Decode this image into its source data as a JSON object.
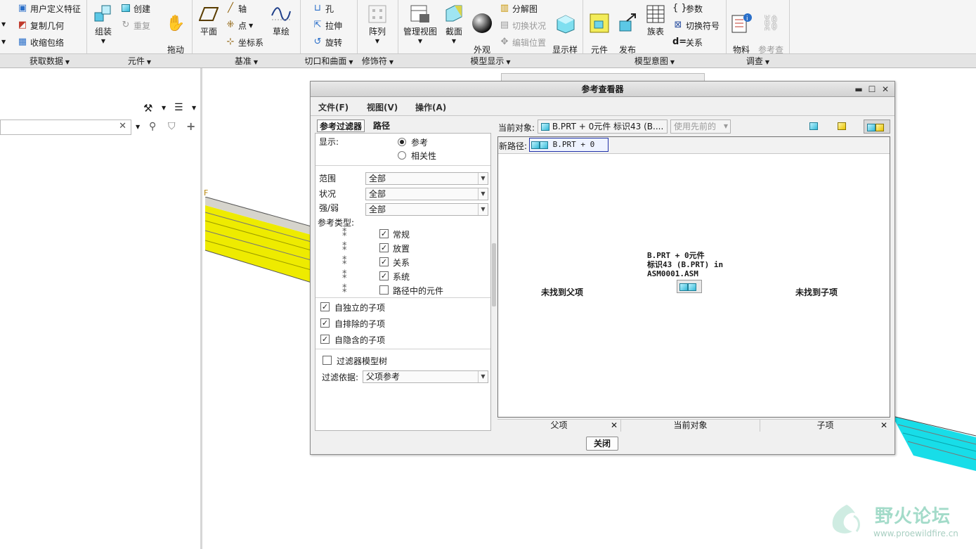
{
  "ribbon": {
    "get_data": {
      "label": "获取数据",
      "items": [
        "用户定义特征",
        "复制几何",
        "收缩包络"
      ]
    },
    "component": {
      "label": "元件",
      "assemble": "组装",
      "create": "创建",
      "repeat": "重复",
      "drag": "拖动\n元件"
    },
    "datum": {
      "label": "基准",
      "plane": "平面",
      "axis": "轴",
      "point": "点",
      "csys": "坐标系",
      "sketch": "草绘"
    },
    "cut_surface": {
      "label": "切口和曲面",
      "hole": "孔",
      "extrude": "拉伸",
      "revolve": "旋转"
    },
    "modifier": {
      "label": "修饰符",
      "pattern": "阵列"
    },
    "model_display": {
      "label": "模型显示",
      "manage_views": "管理视图",
      "section": "截面",
      "appearance": "外观\n库",
      "exploded": "分解图",
      "toggle_status": "切换状况",
      "edit_position": "编辑位置",
      "display_style": "显示样\n式"
    },
    "model_intent": {
      "label": "模型意图",
      "component_interface": "元件\n界面",
      "publish_geom": "发布\n几何",
      "family_table": "族表",
      "parameters": "参数",
      "switch_symbols": "切换符号",
      "relations": "关系"
    },
    "investigate": {
      "label": "调查",
      "bom": "物料\n清单",
      "ref_viewer": "参考查\n看器"
    }
  },
  "model_label": "F",
  "dialog": {
    "title": "参考查看器",
    "menu": [
      "文件(F)",
      "视图(V)",
      "操作(A)"
    ],
    "tabs": [
      "参考过滤器",
      "路径"
    ],
    "show_label": "显示:",
    "show_options": [
      "参考",
      "相关性"
    ],
    "scope_label": "范围",
    "scope_value": "全部",
    "status_label": "状况",
    "status_value": "全部",
    "strength_label": "强/弱",
    "strength_value": "全部",
    "ref_type_label": "参考类型:",
    "ref_types": [
      {
        "label": "常规",
        "checked": true
      },
      {
        "label": "放置",
        "checked": true
      },
      {
        "label": "关系",
        "checked": true
      },
      {
        "label": "系统",
        "checked": true
      },
      {
        "label": "路径中的元件",
        "checked": false
      }
    ],
    "children_opts": [
      {
        "label": "自独立的子项",
        "checked": true
      },
      {
        "label": "自排除的子项",
        "checked": true
      },
      {
        "label": "自隐含的子项",
        "checked": true
      }
    ],
    "filter_model_tree": "过滤器模型树",
    "filter_by_label": "过滤依据:",
    "filter_by_value": "父项参考",
    "current_object_label": "当前对象:",
    "current_object_value": "B.PRT + 0元件 标识43 (B....",
    "use_previous": "使用先前的",
    "new_path_label": "新路径:",
    "new_path_value": "B.PRT + 0",
    "node_text_1": "B.PRT + 0元件",
    "node_text_2": "标识43 (B.PRT) in",
    "node_text_3": "ASM0001.ASM",
    "no_parent": "未找到父项",
    "no_child": "未找到子项",
    "col_parent": "父项",
    "col_current": "当前对象",
    "col_child": "子项",
    "close": "关闭"
  },
  "watermark": {
    "name": "野火论坛",
    "url": "www.proewildfire.cn"
  },
  "colors": {
    "beam_yellow": "#f3f000",
    "beam_cyan": "#19e2ec",
    "watermark": "#a3dbc9"
  }
}
